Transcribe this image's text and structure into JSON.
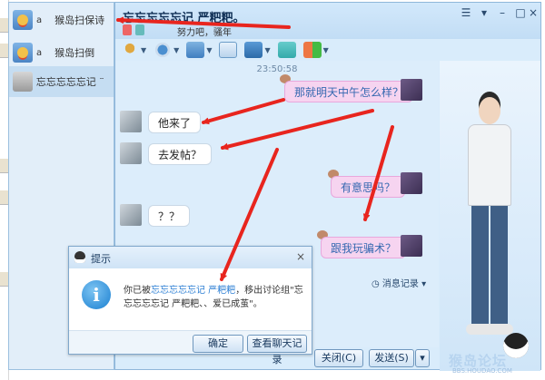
{
  "sidebar": {
    "items": [
      {
        "prefix": "a",
        "name": "猴岛扫保诗"
      },
      {
        "prefix": "a",
        "name": "猴岛扫倒"
      },
      {
        "prefix": "",
        "name": "忘忘忘忘忘记 ¨"
      }
    ]
  },
  "window": {
    "title": "忘忘忘忘忘记 严粑粑。",
    "signature": "努力吧，骚年"
  },
  "toolbar": {
    "icons": [
      "mic-icon",
      "camera-icon",
      "file-transfer-icon",
      "message-icon",
      "screen-share-icon",
      "remote-share-icon",
      "apps-icon"
    ]
  },
  "chat": {
    "timestamp": "23:50:58",
    "messages": [
      {
        "side": "right",
        "text": "那就明天中午怎么样？"
      },
      {
        "side": "left",
        "text": "他来了"
      },
      {
        "side": "left",
        "text": "去发帖？"
      },
      {
        "side": "right",
        "text": "有意思吗？"
      },
      {
        "side": "left",
        "text": "？？"
      },
      {
        "side": "right",
        "text": "跟我玩骗术？"
      }
    ],
    "history_label": "消息记录"
  },
  "buttons": {
    "close": "关闭(C)",
    "send": "发送(S)"
  },
  "dialog": {
    "title": "提示",
    "text_prefix": "你已被",
    "text_highlight": "忘忘忘忘忘记 严粑粑",
    "text_suffix": "，移出讨论组\"忘忘忘忘忘记 严粑粑、、爱已成茧\"。",
    "ok": "确定",
    "view_history": "查看聊天记录"
  },
  "watermark": {
    "text": "猴岛论坛",
    "url": "BBS.HOUDAO.COM"
  },
  "colors": {
    "arrow": "#e8251e",
    "accent": "#3468b0"
  }
}
